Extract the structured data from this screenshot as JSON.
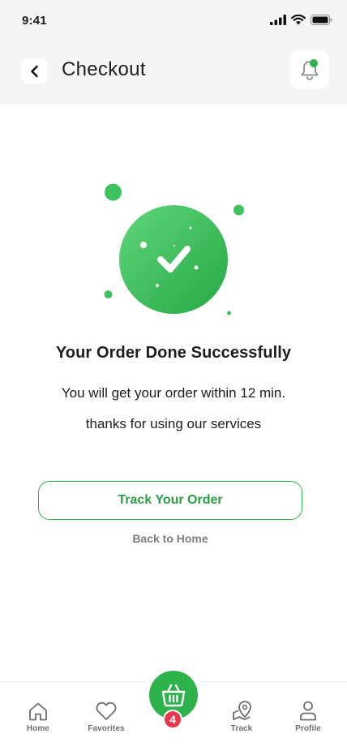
{
  "status_bar": {
    "time": "9:41"
  },
  "header": {
    "title": "Checkout"
  },
  "confirmation": {
    "headline": "Your Order Done Successfully",
    "line1": "You will get your order within 12 min.",
    "line2": "thanks for using our services"
  },
  "actions": {
    "track_label": "Track Your Order",
    "home_label": "Back to Home"
  },
  "bottom_nav": {
    "items": [
      {
        "label": "Home",
        "icon": "home-icon"
      },
      {
        "label": "Favorites",
        "icon": "heart-icon"
      },
      {
        "label": "Track",
        "icon": "map-pin-icon"
      },
      {
        "label": "Profile",
        "icon": "user-icon"
      }
    ],
    "cart_badge": "4"
  },
  "colors": {
    "accent_green": "#2eb24c",
    "badge_red": "#e8384f",
    "header_bg": "#f5f5f5"
  }
}
